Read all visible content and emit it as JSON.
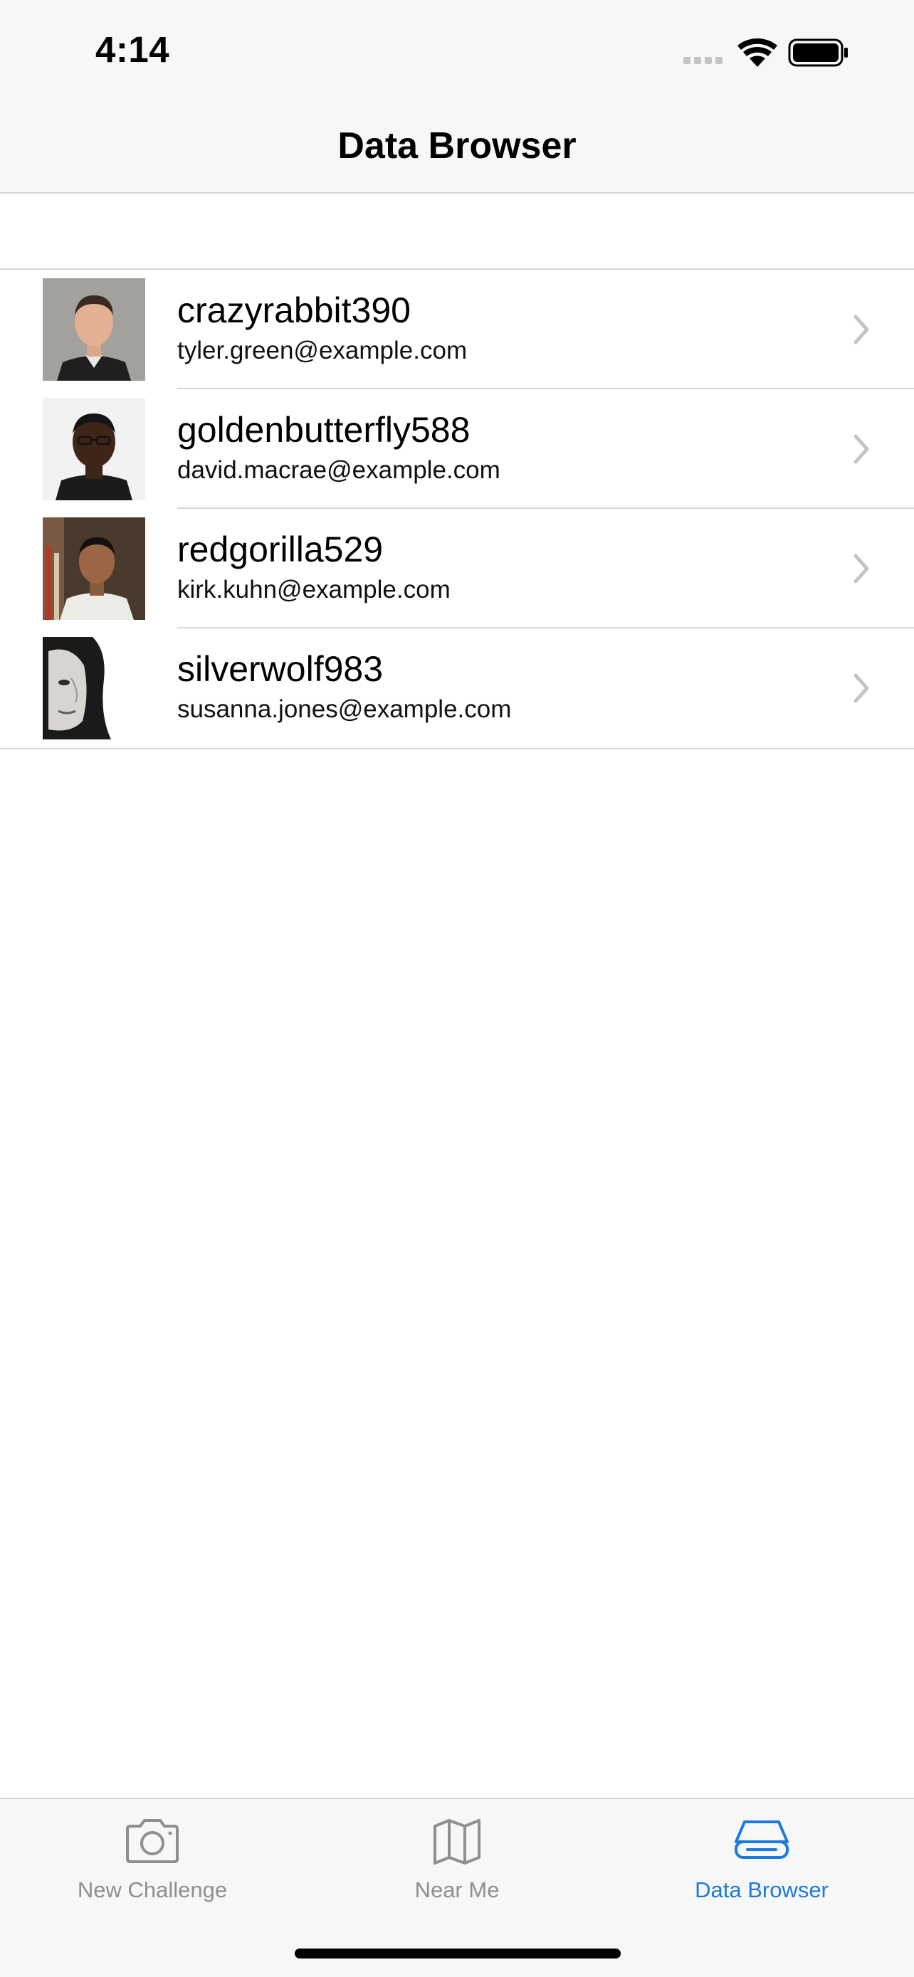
{
  "status_bar": {
    "time": "4:14"
  },
  "nav": {
    "title": "Data Browser"
  },
  "users": [
    {
      "username": "crazyrabbit390",
      "email": "tyler.green@example.com",
      "avatar": "man-suit-portrait"
    },
    {
      "username": "goldenbutterfly588",
      "email": "david.macrae@example.com",
      "avatar": "man-glasses-portrait"
    },
    {
      "username": "redgorilla529",
      "email": "kirk.kuhn@example.com",
      "avatar": "man-white-shirt-portrait"
    },
    {
      "username": "silverwolf983",
      "email": "susanna.jones@example.com",
      "avatar": "woman-bw-portrait"
    }
  ],
  "tabs": [
    {
      "label": "New Challenge",
      "icon": "camera-icon",
      "active": false
    },
    {
      "label": "Near Me",
      "icon": "map-icon",
      "active": false
    },
    {
      "label": "Data Browser",
      "icon": "drive-icon",
      "active": true
    }
  ],
  "colors": {
    "accent": "#1a7ae0",
    "inactive_tab": "#8e8e93",
    "bar_background": "#f7f7f7",
    "separator": "#d8d8dc"
  }
}
